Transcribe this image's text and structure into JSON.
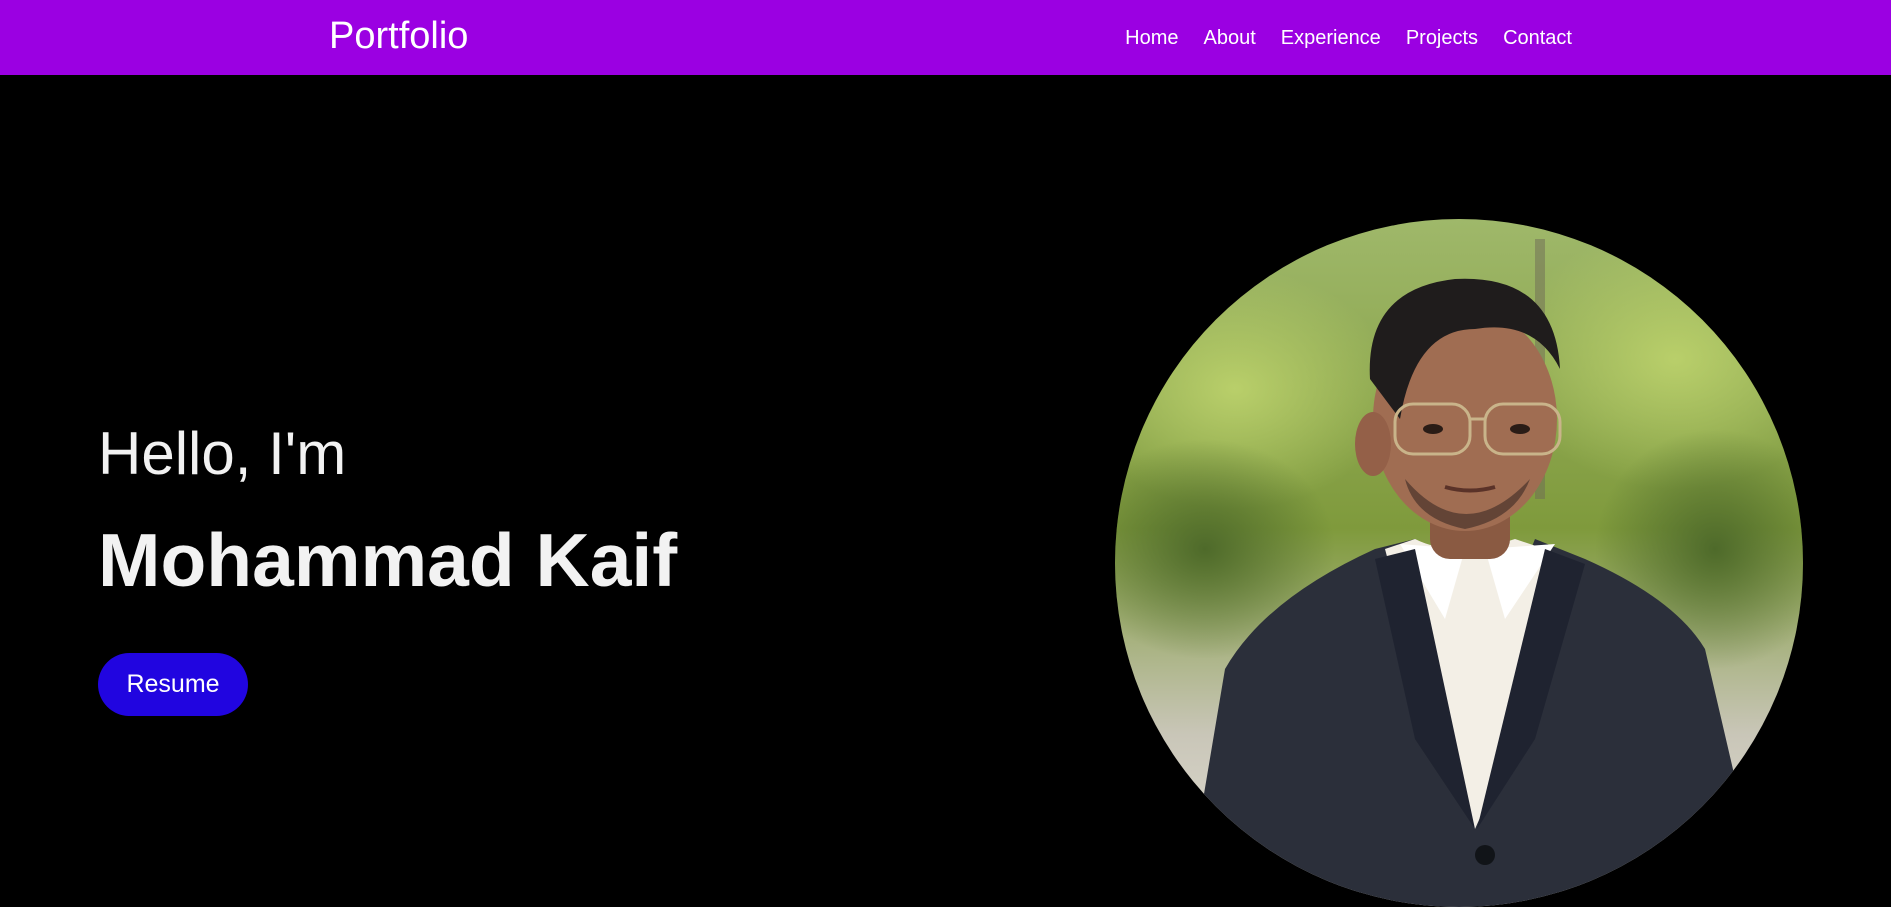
{
  "header": {
    "brand": "Portfolio",
    "nav": [
      "Home",
      "About",
      "Experience",
      "Projects",
      "Contact"
    ]
  },
  "hero": {
    "greeting": "Hello, I'm",
    "name": "Mohammad Kaif",
    "resume_label": "Resume"
  },
  "colors": {
    "navbar": "#9b00e2",
    "background": "#000000",
    "button": "#2105e0",
    "text": "#f2f2f2"
  },
  "images": {
    "portrait": "profile-photo"
  }
}
